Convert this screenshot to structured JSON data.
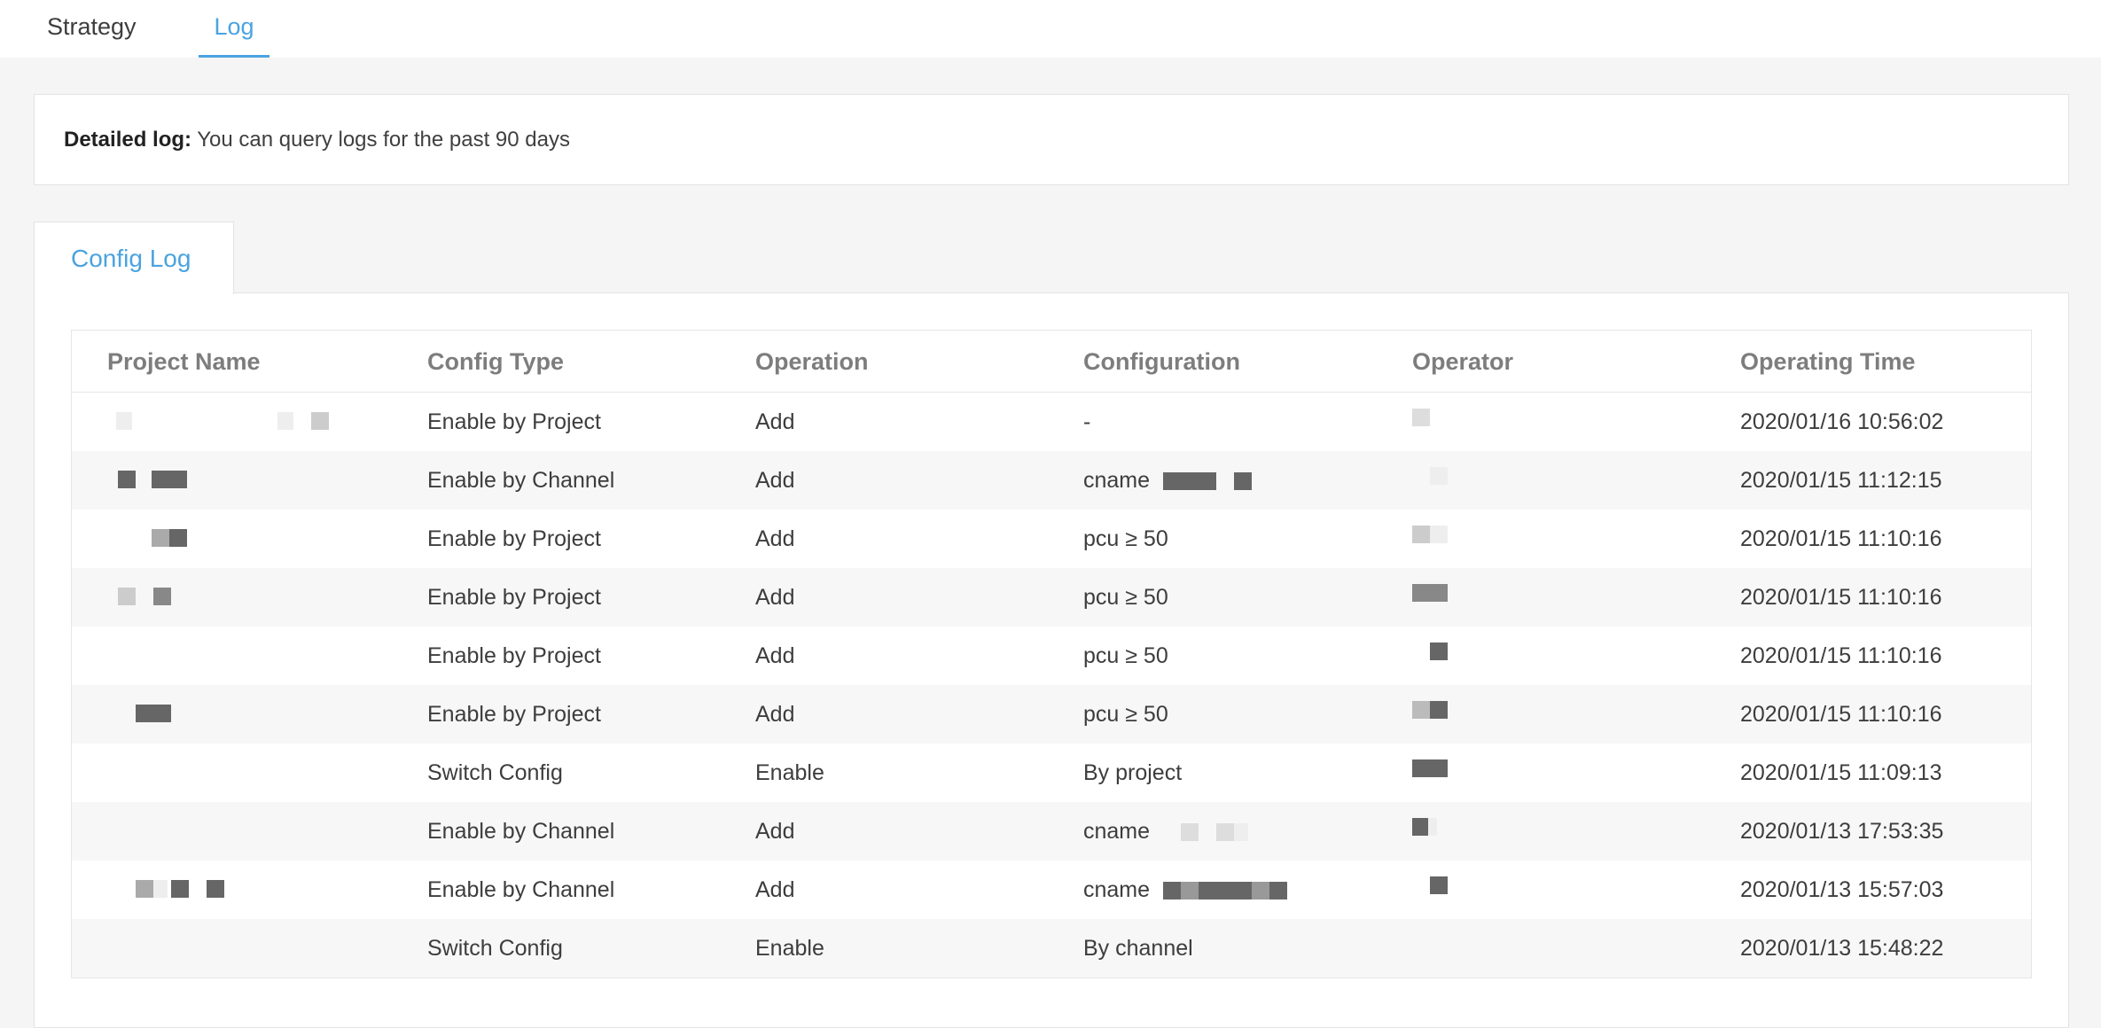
{
  "tabs": [
    {
      "label": "Strategy",
      "active": false
    },
    {
      "label": "Log",
      "active": true
    }
  ],
  "info": {
    "title": "Detailed log:",
    "text": "You can query logs for the past 90 days"
  },
  "panel_tab": "Config Log",
  "colors": {
    "accent": "#4aa3e0",
    "redaction_dark": "#666666",
    "redaction_light": "#cccccc"
  },
  "table": {
    "headers": [
      "Project Name",
      "Config Type",
      "Operation",
      "Configuration",
      "Operator",
      "Operating Time"
    ],
    "rows": [
      {
        "config_type": "Enable by Project",
        "operation": "Add",
        "configuration": "-",
        "operating_time": "2020/01/16 10:56:02"
      },
      {
        "config_type": "Enable by Channel",
        "operation": "Add",
        "configuration": "cname",
        "operating_time": "2020/01/15 11:12:15"
      },
      {
        "config_type": "Enable by Project",
        "operation": "Add",
        "configuration": "pcu ≥ 50",
        "operating_time": "2020/01/15 11:10:16"
      },
      {
        "config_type": "Enable by Project",
        "operation": "Add",
        "configuration": "pcu ≥ 50",
        "operating_time": "2020/01/15 11:10:16"
      },
      {
        "config_type": "Enable by Project",
        "operation": "Add",
        "configuration": "pcu ≥ 50",
        "operating_time": "2020/01/15 11:10:16"
      },
      {
        "config_type": "Enable by Project",
        "operation": "Add",
        "configuration": "pcu ≥ 50",
        "operating_time": "2020/01/15 11:10:16"
      },
      {
        "config_type": "Switch Config",
        "operation": "Enable",
        "configuration": "By project",
        "operating_time": "2020/01/15 11:09:13"
      },
      {
        "config_type": "Enable by Channel",
        "operation": "Add",
        "configuration": "cname",
        "operating_time": "2020/01/13 17:53:35"
      },
      {
        "config_type": "Enable by Channel",
        "operation": "Add",
        "configuration": "cname",
        "operating_time": "2020/01/13 15:57:03"
      },
      {
        "config_type": "Switch Config",
        "operation": "Enable",
        "configuration": "By channel",
        "operating_time": "2020/01/13 15:48:22"
      }
    ]
  }
}
